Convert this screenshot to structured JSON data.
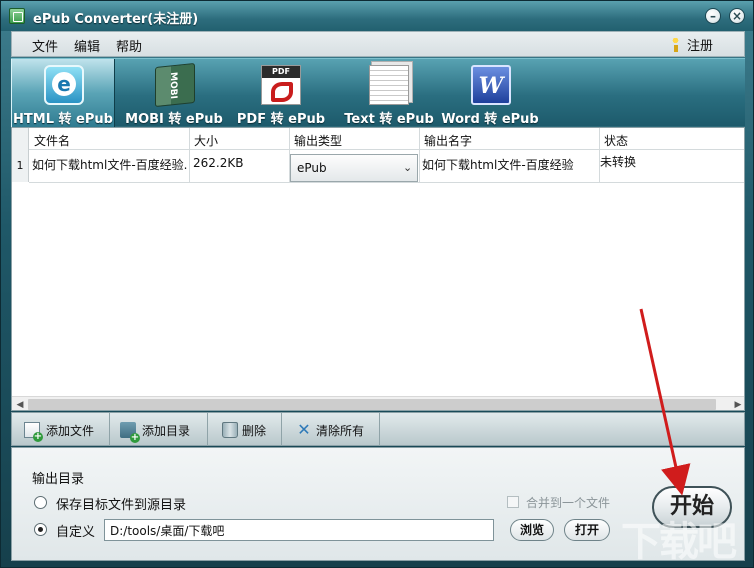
{
  "window": {
    "title": "ePub Converter(未注册)"
  },
  "menu": {
    "file": "文件",
    "edit": "编辑",
    "help": "帮助",
    "register": "注册"
  },
  "modes": [
    {
      "label": "HTML 转 ePub",
      "icon": "html-icon",
      "active": true
    },
    {
      "label": "MOBI 转 ePub",
      "icon": "mobi-book-icon",
      "active": false
    },
    {
      "label": "PDF 转 ePub",
      "icon": "pdf-icon",
      "active": false
    },
    {
      "label": "Text 转 ePub",
      "icon": "text-document-icon",
      "active": false
    },
    {
      "label": "Word 转 ePub",
      "icon": "word-icon",
      "active": false
    }
  ],
  "table": {
    "headers": {
      "name": "文件名",
      "size": "大小",
      "type": "输出类型",
      "outname": "输出名字",
      "status": "状态"
    },
    "rows": [
      {
        "index": "1",
        "name": "如何下载html文件-百度经验.l",
        "size": "262.2KB",
        "type": "ePub",
        "outname": "如何下载html文件-百度经验",
        "status": "未转换"
      }
    ]
  },
  "actions": {
    "add_file": "添加文件",
    "add_dir": "添加目录",
    "delete": "删除",
    "clear_all": "清除所有"
  },
  "output": {
    "title": "输出目录",
    "option_source": "保存目标文件到源目录",
    "option_custom": "自定义",
    "path": "D:/tools/桌面/下载吧",
    "merge": "合并到一个文件",
    "browse": "浏览",
    "open": "打开",
    "start": "开始"
  },
  "watermark": "下载吧",
  "colors": {
    "accent": "#2a6e80",
    "annotation_arrow": "#d01c1c"
  }
}
